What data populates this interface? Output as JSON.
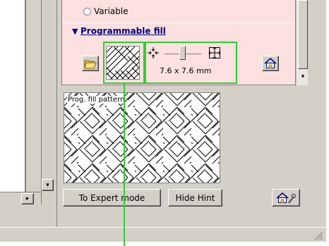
{
  "radio_option": "Variable",
  "section_title": "Programmable fill",
  "section_toggle_glyph": "▼",
  "size_value": "7.6 x 7.6 mm",
  "pattern_caption": "Prog. fill pattern",
  "buttons": {
    "expert": "To Expert mode",
    "hint": "Hide Hint"
  },
  "icons": {
    "open": "folder-open-icon",
    "home": "home-icon",
    "settings": "home-wrench-icon",
    "shrink": "shrink-arrows-icon",
    "expand": "expand-arrows-icon"
  },
  "colors": {
    "callout": "#33cc33",
    "panel_bg": "#fde0e0",
    "title": "#000080"
  }
}
